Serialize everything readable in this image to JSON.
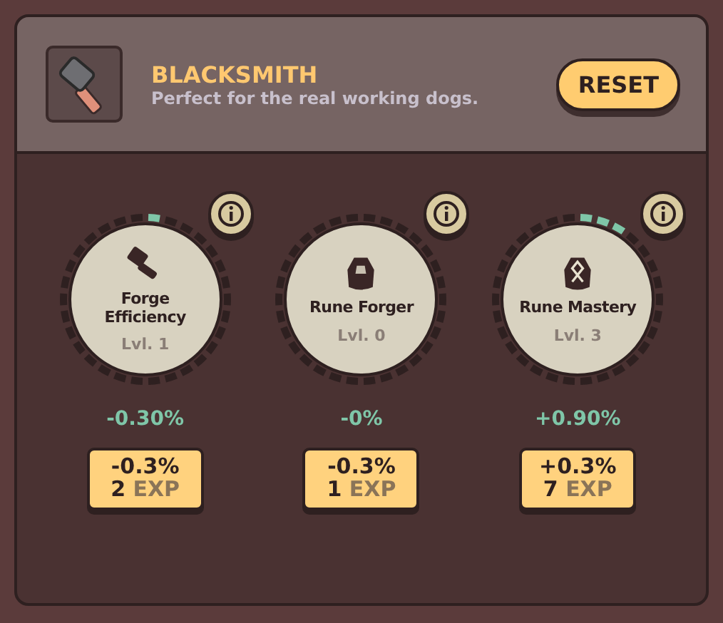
{
  "header": {
    "title": "BLACKSMITH",
    "subtitle": "Perfect for the real working dogs.",
    "reset": "RESET"
  },
  "skills": [
    {
      "kind": "hammer",
      "name": "Forge Efficiency",
      "level_text": "Lvl. 1",
      "bonus": "-0.30%",
      "cost_effect": "-0.3%",
      "cost_amount": "2",
      "cost_unit": "EXP",
      "ring": [
        {
          "filled": true
        },
        {
          "filled": false
        },
        {
          "filled": false
        },
        {
          "filled": false
        },
        {
          "filled": false
        },
        {
          "filled": false
        },
        {
          "filled": false
        },
        {
          "filled": false
        },
        {
          "filled": false
        },
        {
          "filled": false
        },
        {
          "filled": false
        },
        {
          "filled": false
        },
        {
          "filled": false
        },
        {
          "filled": false
        },
        {
          "filled": false
        },
        {
          "filled": false
        },
        {
          "filled": false
        },
        {
          "filled": false
        },
        {
          "filled": false
        },
        {
          "filled": false
        },
        {
          "filled": false
        },
        {
          "filled": false
        },
        {
          "filled": false
        },
        {
          "filled": false
        },
        {
          "filled": false
        },
        {
          "filled": false
        },
        {
          "filled": false
        },
        {
          "filled": false
        },
        {
          "filled": false
        },
        {
          "filled": false
        }
      ]
    },
    {
      "kind": "stone",
      "name": "Rune Forger",
      "level_text": "Lvl. 0",
      "bonus": "-0%",
      "cost_effect": "-0.3%",
      "cost_amount": "1",
      "cost_unit": "EXP",
      "ring": [
        {
          "filled": false
        },
        {
          "filled": false
        },
        {
          "filled": false
        },
        {
          "filled": false
        },
        {
          "filled": false
        },
        {
          "filled": false
        },
        {
          "filled": false
        },
        {
          "filled": false
        },
        {
          "filled": false
        },
        {
          "filled": false
        },
        {
          "filled": false
        },
        {
          "filled": false
        },
        {
          "filled": false
        },
        {
          "filled": false
        },
        {
          "filled": false
        },
        {
          "filled": false
        },
        {
          "filled": false
        },
        {
          "filled": false
        },
        {
          "filled": false
        },
        {
          "filled": false
        },
        {
          "filled": false
        },
        {
          "filled": false
        },
        {
          "filled": false
        },
        {
          "filled": false
        },
        {
          "filled": false
        },
        {
          "filled": false
        },
        {
          "filled": false
        },
        {
          "filled": false
        },
        {
          "filled": false
        },
        {
          "filled": false
        }
      ]
    },
    {
      "kind": "rune",
      "name": "Rune Mastery",
      "level_text": "Lvl. 3",
      "bonus": "+0.90%",
      "cost_effect": "+0.3%",
      "cost_amount": "7",
      "cost_unit": "EXP",
      "ring": [
        {
          "filled": true
        },
        {
          "filled": true
        },
        {
          "filled": true
        },
        {
          "filled": false
        },
        {
          "filled": false
        },
        {
          "filled": false
        },
        {
          "filled": false
        },
        {
          "filled": false
        },
        {
          "filled": false
        },
        {
          "filled": false
        },
        {
          "filled": false
        },
        {
          "filled": false
        },
        {
          "filled": false
        },
        {
          "filled": false
        },
        {
          "filled": false
        },
        {
          "filled": false
        },
        {
          "filled": false
        },
        {
          "filled": false
        },
        {
          "filled": false
        },
        {
          "filled": false
        },
        {
          "filled": false
        },
        {
          "filled": false
        },
        {
          "filled": false
        },
        {
          "filled": false
        },
        {
          "filled": false
        },
        {
          "filled": false
        },
        {
          "filled": false
        },
        {
          "filled": false
        },
        {
          "filled": false
        },
        {
          "filled": false
        }
      ]
    }
  ]
}
